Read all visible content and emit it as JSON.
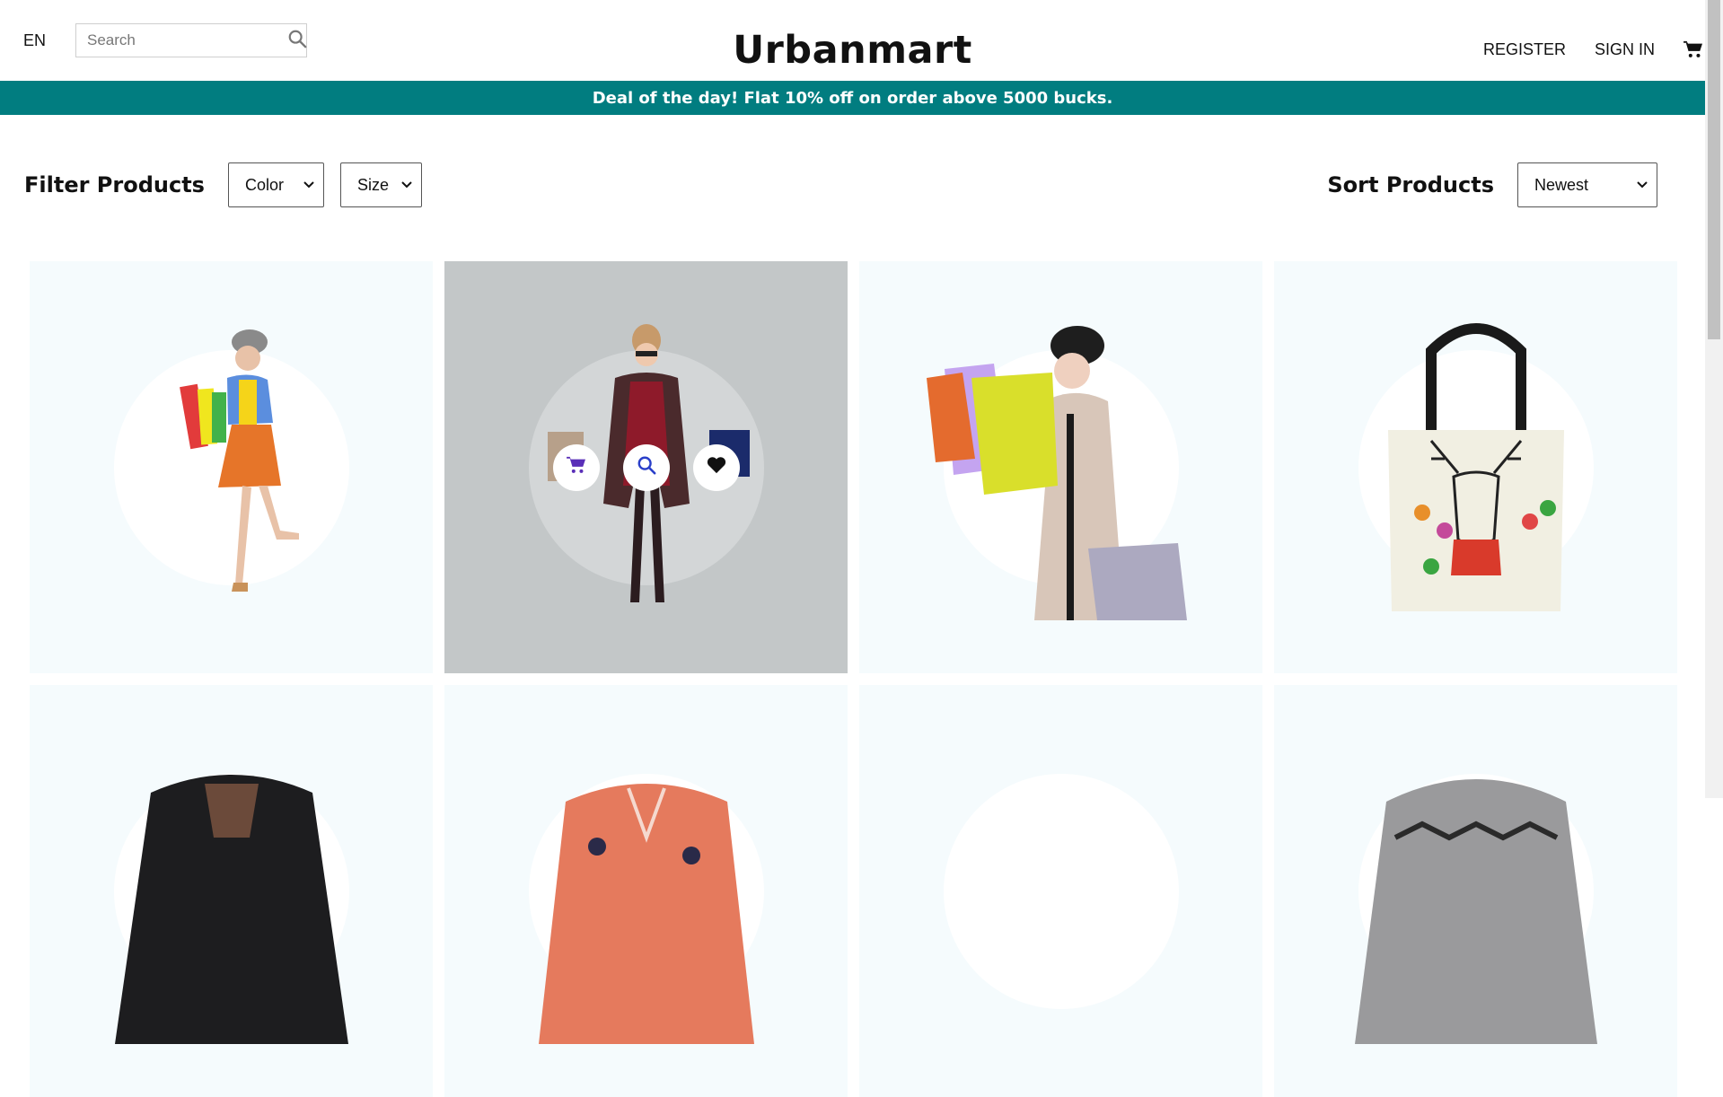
{
  "header": {
    "language": "EN",
    "search_placeholder": "Search",
    "logo": "Urbanmart",
    "register_label": "REGISTER",
    "signin_label": "SIGN IN"
  },
  "announcement": "Deal of the day! Flat 10% off on order above 5000 bucks.",
  "filters": {
    "title": "Filter Products",
    "color_selected": "Color",
    "size_selected": "Size"
  },
  "sort": {
    "title": "Sort Products",
    "selected": "Newest"
  },
  "products": [
    {
      "image": "woman-with-colorful-shopping-bags",
      "hovered": false
    },
    {
      "image": "woman-in-red-dress-with-bags",
      "hovered": true
    },
    {
      "image": "woman-in-beige-coat-with-bags",
      "hovered": false
    },
    {
      "image": "reindeer-tote-bag",
      "hovered": false
    },
    {
      "image": "black-leather-jacket",
      "hovered": false
    },
    {
      "image": "floral-orange-blouse",
      "hovered": false
    },
    {
      "image": "product-7",
      "hovered": false
    },
    {
      "image": "grey-knit-sweater",
      "hovered": false
    }
  ],
  "product_actions": [
    "cart-icon",
    "search-icon",
    "heart-icon"
  ],
  "colors": {
    "announcement_bg": "#017d80",
    "card_bg": "#f5fbfd",
    "hover_overlay": "#c3c7c8",
    "action_icon": "#5a2fb8"
  }
}
